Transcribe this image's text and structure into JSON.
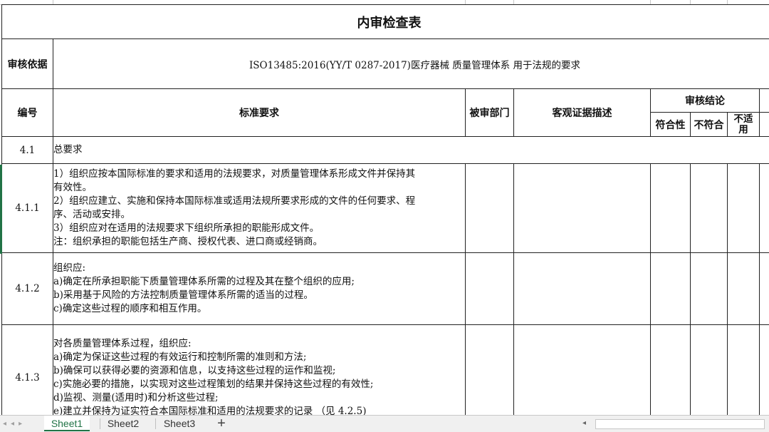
{
  "sheet": {
    "title": "内审检查表",
    "basis_label": "审核依据",
    "basis_text": "ISO13485:2016(YY/T 0287-2017)医疗器械 质量管理体系 用于法规的要求",
    "headers": {
      "number": "编号",
      "requirement": "标准要求",
      "department": "被审部门",
      "evidence": "客观证据描述",
      "conclusion": "审核结论",
      "conforms": "符合性",
      "nonconforms": "不符合",
      "na_line1": "不适",
      "na_line2": "用"
    },
    "rows": [
      {
        "id": "4.1",
        "lines": [
          "总要求"
        ]
      },
      {
        "id": "4.1.1",
        "lines": [
          "1）组织应按本国际标准的要求和适用的法规要求，对质量管理体系形成文件并保持其",
          "有效性。",
          "2）组织应建立、实施和保持本国际标准或适用法规所要求形成的文件的任何要求、程",
          "序、活动或安排。",
          "3）组织应对在适用的法规要求下组织所承担的职能形成文件。",
          "注：组织承担的职能包括生产商、授权代表、进口商或经销商。"
        ]
      },
      {
        "id": "4.1.2",
        "lines": [
          "组织应:",
          "a)确定在所承担职能下质量管理体系所需的过程及其在整个组织的应用;",
          "b)采用基于风险的方法控制质量管理体系所需的适当的过程。",
          "c)确定这些过程的顺序和相互作用。"
        ]
      },
      {
        "id": "4.1.3",
        "lines": [
          "对各质量管理体系过程，组织应:",
          "a)确定为保证这些过程的有效运行和控制所需的准则和方法;",
          "b)确保可以获得必要的资源和信息，以支持这些过程的运作和监视;",
          "c)实施必要的措施，以实现对这些过程策划的结果并保持这些过程的有效性;",
          "d)监视、测量(适用时)和分析这些过程;",
          "e)建立并保持为证实符合本国际标准和适用的法规要求的记录 （见 4.2.5)"
        ]
      }
    ]
  },
  "tabs": [
    {
      "label": "Sheet1",
      "active": true
    },
    {
      "label": "Sheet2",
      "active": false
    },
    {
      "label": "Sheet3",
      "active": false
    }
  ],
  "add_tab_label": "+",
  "colors": {
    "accent": "#217346",
    "grid": "#222222"
  },
  "icons": {
    "add": "plus-icon",
    "nav": "sheet-nav-arrow-icon"
  }
}
